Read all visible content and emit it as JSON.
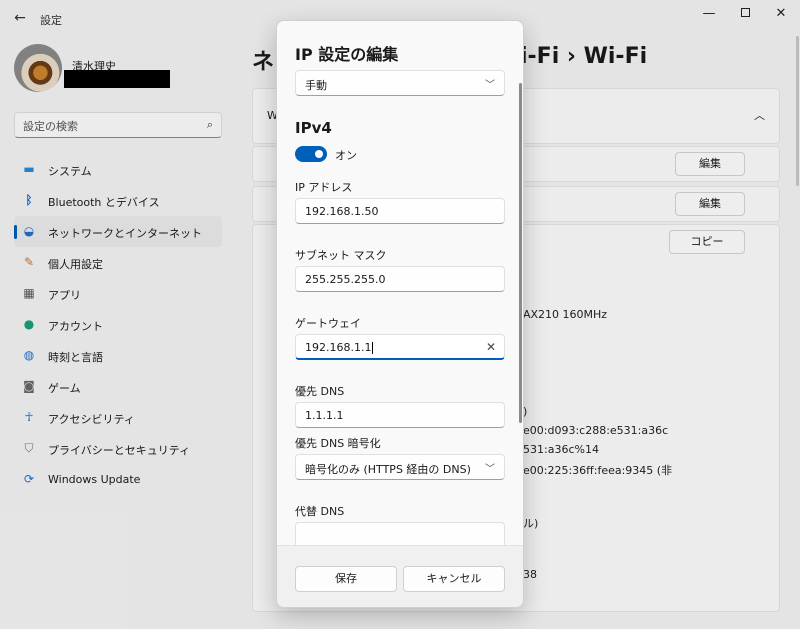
{
  "app": {
    "title": "設定"
  },
  "window": {
    "minimize": "—",
    "close": "✕"
  },
  "profile": {
    "name": "清水理史"
  },
  "search": {
    "placeholder": "設定の検索"
  },
  "nav": {
    "items": [
      {
        "label": "システム",
        "icon": "monitor-icon"
      },
      {
        "label": "Bluetooth とデバイス",
        "icon": "bluetooth-icon"
      },
      {
        "label": "ネットワークとインターネット",
        "icon": "wifi-icon",
        "active": true
      },
      {
        "label": "個人用設定",
        "icon": "brush-icon"
      },
      {
        "label": "アプリ",
        "icon": "apps-icon"
      },
      {
        "label": "アカウント",
        "icon": "account-icon"
      },
      {
        "label": "時刻と言語",
        "icon": "globe-icon"
      },
      {
        "label": "ゲーム",
        "icon": "gamepad-icon"
      },
      {
        "label": "アクセシビリティ",
        "icon": "accessibility-icon"
      },
      {
        "label": "プライバシーとセキュリティ",
        "icon": "shield-icon"
      },
      {
        "label": "Windows Update",
        "icon": "update-icon"
      }
    ]
  },
  "main": {
    "heading_left": "ネ",
    "heading_right": "i-Fi  ›  Wi-Fi",
    "card_w": "W",
    "edit_label": "編集",
    "copy_label": "コピー",
    "fragments": [
      "AX210 160MHz",
      ")",
      "e00:d093:c288:e531:a36c",
      "531:a36c%14",
      "e00:225:36ff:feea:9345 (非",
      "ル)",
      "38"
    ]
  },
  "dialog": {
    "title": "IP 設定の編集",
    "mode": "手動",
    "section": "IPv4",
    "toggle_label": "オン",
    "ip_label": "IP アドレス",
    "ip_value": "192.168.1.50",
    "subnet_label": "サブネット マスク",
    "subnet_value": "255.255.255.0",
    "gateway_label": "ゲートウェイ",
    "gateway_value": "192.168.1.1",
    "dns_label": "優先 DNS",
    "dns_value": "1.1.1.1",
    "dns_enc_label": "優先 DNS 暗号化",
    "dns_enc_value": "暗号化のみ (HTTPS 経由の DNS)",
    "alt_dns_label": "代替 DNS",
    "save": "保存",
    "cancel": "キャンセル"
  }
}
